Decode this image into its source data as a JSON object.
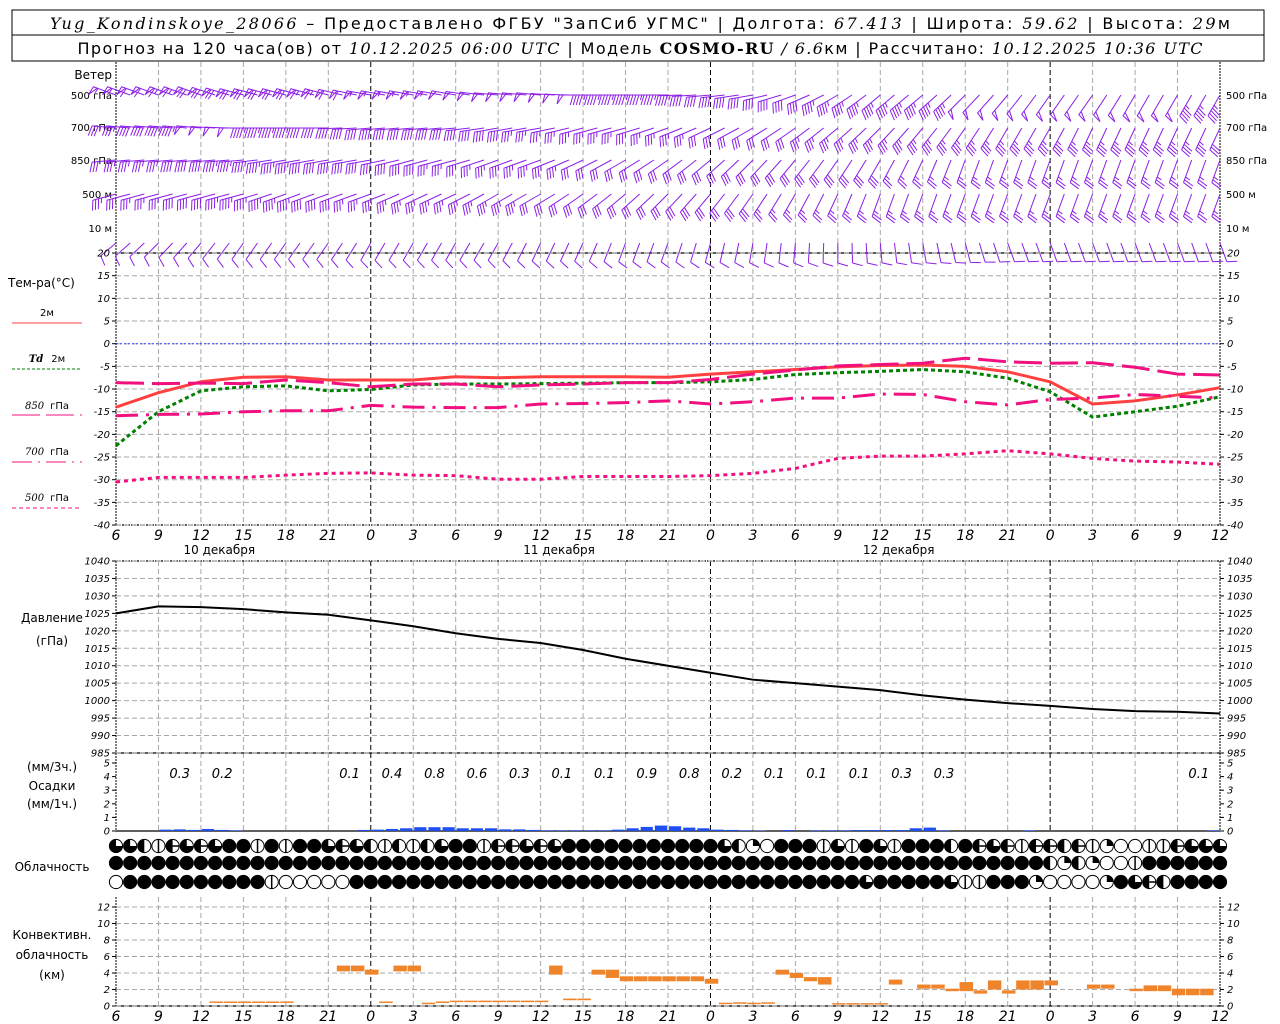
{
  "header": {
    "station": "Yug_Kondinskoye_28066",
    "provided": " – Предоставлено ФГБУ \"ЗапСиб УГМС\" | Долгота: ",
    "lon": "67.413",
    "lat_label": " | Широта: ",
    "lat": "59.62",
    "alt_label": " | Высота: ",
    "alt": "29",
    "alt_unit": "м",
    "forecast_label": "Прогноз на 120 часа(ов) от ",
    "init": "10.12.2025 06:00 UTC",
    "model_label": "  | Модель ",
    "model": "COSMO-RU",
    "res": " / 6.6",
    "res_unit": "км",
    "calc_label": " | Рассчитано: ",
    "calc": "10.12.2025 10:36 UTC"
  },
  "colors": {
    "t2m": "#ff4040",
    "td2m": "#008000",
    "upper_levels": "#f0107f",
    "wind": "#8c1ee6",
    "precip": "#1f4ff0",
    "convective": "#f0842a",
    "zero_line": "#2040ff"
  },
  "chart_data": [
    {
      "type": "wind_barbs",
      "title": "Ветер",
      "x": [
        "6",
        "9",
        "12",
        "15",
        "18",
        "21",
        "0",
        "3",
        "6",
        "9",
        "12",
        "15",
        "18",
        "21",
        "0",
        "3",
        "6",
        "9",
        "12",
        "15",
        "18",
        "21",
        "0",
        "3",
        "6",
        "9",
        "12"
      ],
      "levels": [
        {
          "name": "500 гПа",
          "direction_deg": [
            290,
            290,
            290,
            285,
            285,
            285,
            280,
            280,
            280,
            275,
            275,
            270,
            270,
            270,
            265,
            260,
            250,
            240,
            230,
            230,
            225,
            220,
            215,
            215,
            210,
            210,
            210
          ],
          "speed": [
            28,
            30,
            34,
            35,
            35,
            32,
            28,
            27,
            26,
            25,
            25,
            24,
            22,
            22,
            20,
            20,
            20,
            22,
            22,
            22,
            24,
            24,
            24,
            25,
            25,
            24,
            22
          ]
        },
        {
          "name": "700 гПа",
          "direction_deg": [
            275,
            275,
            275,
            270,
            270,
            270,
            265,
            265,
            265,
            260,
            260,
            255,
            255,
            250,
            245,
            240,
            235,
            230,
            225,
            220,
            215,
            210,
            210,
            205,
            205,
            205,
            205
          ],
          "speed": [
            18,
            20,
            24,
            24,
            22,
            20,
            20,
            20,
            20,
            20,
            18,
            18,
            18,
            17,
            16,
            16,
            16,
            17,
            17,
            18,
            18,
            18,
            18,
            18,
            18,
            17,
            16
          ]
        },
        {
          "name": "850 гПа",
          "direction_deg": [
            265,
            265,
            265,
            265,
            260,
            260,
            260,
            255,
            255,
            250,
            250,
            245,
            240,
            235,
            230,
            225,
            220,
            215,
            210,
            205,
            200,
            200,
            200,
            200,
            200,
            200,
            200
          ],
          "speed": [
            16,
            18,
            20,
            22,
            22,
            20,
            20,
            20,
            18,
            18,
            17,
            16,
            16,
            15,
            15,
            14,
            14,
            14,
            14,
            13,
            13,
            13,
            13,
            13,
            13,
            13,
            13
          ]
        },
        {
          "name": "500 м",
          "direction_deg": [
            255,
            255,
            255,
            255,
            250,
            250,
            250,
            245,
            245,
            240,
            240,
            235,
            230,
            225,
            220,
            215,
            210,
            205,
            200,
            200,
            200,
            200,
            200,
            200,
            200,
            200,
            200
          ],
          "speed": [
            18,
            18,
            20,
            22,
            22,
            20,
            18,
            18,
            17,
            17,
            16,
            16,
            15,
            15,
            14,
            14,
            13,
            13,
            13,
            13,
            13,
            13,
            13,
            13,
            13,
            13,
            13
          ]
        },
        {
          "name": "10  м",
          "direction_deg": [
            230,
            225,
            220,
            215,
            215,
            215,
            210,
            210,
            210,
            210,
            205,
            205,
            200,
            200,
            195,
            190,
            185,
            180,
            175,
            170,
            165,
            160,
            160,
            160,
            160,
            160,
            160
          ],
          "speed": [
            5,
            5,
            6,
            6,
            6,
            6,
            6,
            6,
            6,
            6,
            6,
            6,
            5,
            5,
            5,
            5,
            5,
            5,
            5,
            5,
            5,
            5,
            4,
            4,
            4,
            4,
            4
          ]
        }
      ]
    },
    {
      "type": "line",
      "title": "Тем-ра(°C)",
      "x": [
        "6",
        "9",
        "12",
        "15",
        "18",
        "21",
        "0",
        "3",
        "6",
        "9",
        "12",
        "15",
        "18",
        "21",
        "0",
        "3",
        "6",
        "9",
        "12",
        "15",
        "18",
        "21",
        "0",
        "3",
        "6",
        "9",
        "12"
      ],
      "day_labels": [
        "10 декабря",
        "11 декабря",
        "12 декабря"
      ],
      "ylim": [
        -40,
        20
      ],
      "yticks": [
        20,
        15,
        10,
        5,
        0,
        -5,
        -10,
        -15,
        -20,
        -25,
        -30,
        -35,
        -40
      ],
      "grid": true,
      "series": [
        {
          "name": "2м",
          "style": "solid",
          "values": [
            -14,
            -10.8,
            -8.4,
            -7.4,
            -7.3,
            -8,
            -8,
            -8,
            -7.3,
            -7.5,
            -7.3,
            -7.3,
            -7.3,
            -7.4,
            -6.7,
            -6.2,
            -5.7,
            -5.1,
            -4.8,
            -4.7,
            -5,
            -6.2,
            -8.4,
            -13.3,
            -12.6,
            -11.3,
            -9.7
          ]
        },
        {
          "name_prefix": "Td",
          "name": "2м",
          "style": "dotted",
          "values": [
            -22.5,
            -15,
            -10.4,
            -9.5,
            -9.3,
            -10.4,
            -10.1,
            -9.1,
            -8.9,
            -8.9,
            -8.8,
            -8.7,
            -8.6,
            -8.6,
            -8.4,
            -7.9,
            -6.8,
            -6.4,
            -6.1,
            -5.7,
            -6.2,
            -7.6,
            -10.6,
            -16.2,
            -15,
            -13.8,
            -11.7
          ]
        },
        {
          "name_prefix": "850",
          "name": "гПа",
          "style": "long-dash",
          "values": [
            -8.6,
            -8.8,
            -8.7,
            -8.8,
            -8,
            -8.6,
            -9.5,
            -8.9,
            -8.9,
            -9.5,
            -9.1,
            -8.9,
            -8.6,
            -8.6,
            -7.9,
            -6.7,
            -5.8,
            -4.9,
            -4.6,
            -4.3,
            -3.2,
            -4,
            -4.3,
            -4.2,
            -5.2,
            -6.7,
            -6.9
          ]
        },
        {
          "name_prefix": "700",
          "name": "гПа",
          "style": "dash-dot",
          "values": [
            -15.9,
            -15.6,
            -15.5,
            -15,
            -14.8,
            -14.8,
            -13.6,
            -14,
            -14.1,
            -14.1,
            -13.3,
            -13.2,
            -13,
            -12.6,
            -13.3,
            -12.8,
            -12,
            -12,
            -11.1,
            -11.2,
            -12.8,
            -13.5,
            -12.3,
            -12,
            -11.2,
            -11.6,
            -12
          ]
        },
        {
          "name_prefix": "500",
          "name": "гПа",
          "style": "short-dash",
          "values": [
            -30.5,
            -29.5,
            -29.5,
            -29.5,
            -29,
            -28.6,
            -28.5,
            -29,
            -29.1,
            -29.9,
            -29.9,
            -29.3,
            -29.3,
            -29.3,
            -29.1,
            -28.6,
            -27.5,
            -25.3,
            -24.8,
            -24.8,
            -24.3,
            -23.6,
            -24.3,
            -25.3,
            -25.9,
            -26.1,
            -26.6
          ]
        }
      ]
    },
    {
      "type": "line",
      "title": "Давление",
      "ylabel": "(гПа)",
      "ylim": [
        985,
        1040
      ],
      "yticks": [
        1040,
        1035,
        1030,
        1025,
        1020,
        1015,
        1010,
        1005,
        1000,
        995,
        990,
        985
      ],
      "grid": true,
      "series": [
        {
          "values": [
            1025,
            1027,
            1026.8,
            1026.2,
            1025.3,
            1024.6,
            1023,
            1021.3,
            1019.3,
            1017.7,
            1016.5,
            1014.5,
            1012,
            1010,
            1008,
            1006,
            1005,
            1004,
            1003,
            1001.5,
            1000.3,
            999.3,
            998.5,
            997.6,
            997,
            996.8,
            996.3
          ]
        }
      ]
    },
    {
      "type": "bar",
      "title": "Осадки",
      "ylabel_top": "(мм/3ч.)",
      "ylabel_bottom": "(мм/1ч.)",
      "ylim": [
        0,
        5
      ],
      "yticks": [
        5,
        4,
        3,
        2,
        1,
        0
      ],
      "three_hour_totals": [
        null,
        "0.3",
        "0.2",
        null,
        null,
        "0.1",
        "0.4",
        "0.8",
        "0.6",
        "0.3",
        "0.1",
        "0.1",
        "0.9",
        "0.8",
        "0.2",
        "0.1",
        "0.1",
        "0.1",
        "0.3",
        "0.3",
        null,
        null,
        null,
        null,
        null,
        "0.1"
      ],
      "hourly": [
        0,
        0,
        0,
        0.1,
        0.12,
        0.08,
        0.15,
        0.08,
        0.05,
        0,
        0,
        0,
        0,
        0,
        0,
        0,
        0,
        0.08,
        0.1,
        0.15,
        0.2,
        0.28,
        0.28,
        0.28,
        0.2,
        0.2,
        0.2,
        0.12,
        0.12,
        0.08,
        0.05,
        0.05,
        0.05,
        0.05,
        0.05,
        0.1,
        0.2,
        0.3,
        0.4,
        0.35,
        0.25,
        0.2,
        0.1,
        0.08,
        0.05,
        0.03,
        0,
        0.07,
        0,
        0.05,
        0.05,
        0.05,
        0.07,
        0.07,
        0.07,
        0.07,
        0.2,
        0.25,
        0.05,
        0,
        0,
        0,
        0,
        0,
        0.05,
        0,
        0,
        0,
        0,
        0,
        0,
        0,
        0,
        0,
        0,
        0,
        0,
        0.05
      ]
    },
    {
      "type": "cloud_symbols",
      "title": "Облачность",
      "coverage_octas_rows": [
        "6641565688181886564141468815565688888888888642088816186188848565155451200115666",
        "8888888888888888888888888888888888888888888888888888888888888888884242001888888",
        "0888888888810000088888888888888888888888888888888888868888861188820000286548888"
      ]
    },
    {
      "type": "bar",
      "title": "Конвективн.",
      "title2": "облачность",
      "ylabel": "(км)",
      "ylim": [
        0,
        12
      ],
      "yticks": [
        12,
        10,
        8,
        6,
        4,
        2,
        0
      ],
      "hourly_base_top_km": [
        null,
        null,
        null,
        null,
        null,
        null,
        null,
        [
          0.4,
          0.55
        ],
        [
          0.4,
          0.55
        ],
        [
          0.4,
          0.55
        ],
        [
          0.4,
          0.55
        ],
        [
          0.4,
          0.55
        ],
        [
          0.4,
          0.55
        ],
        null,
        null,
        null,
        [
          4.2,
          4.9
        ],
        [
          4.2,
          4.9
        ],
        [
          3.8,
          4.4
        ],
        [
          0.4,
          0.55
        ],
        [
          4.2,
          4.9
        ],
        [
          4.2,
          4.9
        ],
        [
          0.3,
          0.4
        ],
        [
          0.45,
          0.55
        ],
        [
          0.5,
          0.65
        ],
        [
          0.5,
          0.65
        ],
        [
          0.5,
          0.65
        ],
        [
          0.5,
          0.65
        ],
        [
          0.5,
          0.65
        ],
        [
          0.5,
          0.65
        ],
        [
          0.5,
          0.65
        ],
        [
          3.8,
          4.9
        ],
        [
          0.7,
          0.9
        ],
        [
          0.7,
          0.9
        ],
        [
          3.8,
          4.4
        ],
        [
          3.4,
          4.4
        ],
        [
          3.0,
          3.6
        ],
        [
          3.0,
          3.6
        ],
        [
          3.0,
          3.6
        ],
        [
          3.0,
          3.6
        ],
        [
          3.0,
          3.6
        ],
        [
          3.0,
          3.6
        ],
        [
          2.7,
          3.3
        ],
        [
          0.3,
          0.4
        ],
        [
          0.35,
          0.45
        ],
        [
          0.3,
          0.4
        ],
        [
          0.35,
          0.45
        ],
        [
          3.8,
          4.4
        ],
        [
          3.4,
          4.0
        ],
        [
          3.0,
          3.5
        ],
        [
          2.6,
          3.5
        ],
        [
          0.25,
          0.35
        ],
        [
          0.25,
          0.35
        ],
        [
          0.25,
          0.35
        ],
        [
          0.25,
          0.35
        ],
        [
          2.6,
          3.2
        ],
        null,
        [
          2.1,
          2.6
        ],
        [
          2.1,
          2.6
        ],
        [
          1.8,
          2.1
        ],
        [
          1.8,
          2.9
        ],
        [
          1.5,
          1.9
        ],
        [
          2.0,
          3.1
        ],
        [
          1.5,
          1.9
        ],
        [
          2.0,
          3.1
        ],
        [
          2.0,
          3.1
        ],
        [
          2.5,
          3.1
        ],
        null,
        null,
        [
          2.1,
          2.6
        ],
        [
          2.1,
          2.6
        ],
        null,
        [
          1.8,
          2.1
        ],
        [
          1.8,
          2.5
        ],
        [
          1.8,
          2.5
        ],
        [
          1.3,
          2.1
        ],
        [
          1.3,
          2.1
        ],
        [
          1.3,
          2.1
        ],
        null
      ]
    }
  ]
}
